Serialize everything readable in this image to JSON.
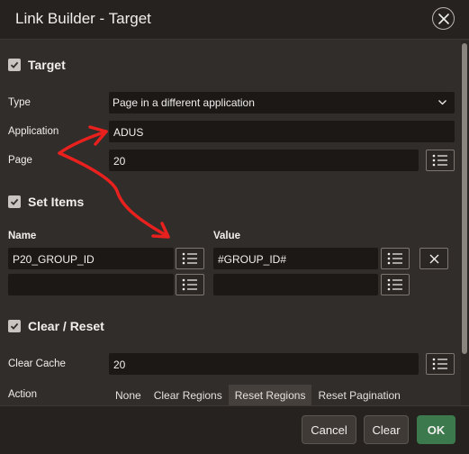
{
  "dialog": {
    "title": "Link Builder - Target"
  },
  "target_section": {
    "title": "Target",
    "type_label": "Type",
    "type_value": "Page in a different application",
    "application_label": "Application",
    "application_value": "ADUS",
    "page_label": "Page",
    "page_value": "20"
  },
  "set_items_section": {
    "title": "Set Items",
    "name_header": "Name",
    "value_header": "Value",
    "rows": [
      {
        "name": "P20_GROUP_ID",
        "value": "#GROUP_ID#"
      },
      {
        "name": "",
        "value": ""
      }
    ]
  },
  "clear_section": {
    "title": "Clear / Reset",
    "clear_cache_label": "Clear Cache",
    "clear_cache_value": "20",
    "action_label": "Action",
    "action_options": [
      "None",
      "Clear Regions",
      "Reset Regions",
      "Reset Pagination"
    ],
    "action_selected": "Reset Regions"
  },
  "footer": {
    "cancel_label": "Cancel",
    "clear_label": "Clear",
    "ok_label": "OK"
  },
  "colors": {
    "background": "#312d2a",
    "field": "#1b1816",
    "ok_button": "#3c7a4d",
    "annotation_arrow": "#e8211e"
  }
}
